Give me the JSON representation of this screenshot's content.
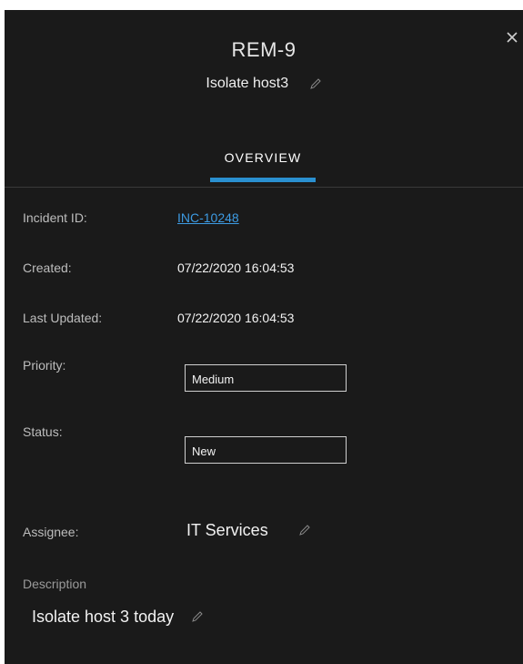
{
  "header": {
    "ticket_id": "REM-9",
    "title": "Isolate host3",
    "close_icon": "close-icon",
    "edit_icon": "pencil-icon"
  },
  "tabs": [
    {
      "label": "OVERVIEW",
      "active": true
    }
  ],
  "fields": {
    "incident_id": {
      "label": "Incident ID:",
      "value": "INC-10248"
    },
    "created": {
      "label": "Created:",
      "value": "07/22/2020 16:04:53"
    },
    "last_updated": {
      "label": "Last Updated:",
      "value": "07/22/2020 16:04:53"
    },
    "priority": {
      "label": "Priority:",
      "value": "Medium"
    },
    "status": {
      "label": "Status:",
      "value": "New"
    },
    "assignee": {
      "label": "Assignee:",
      "value": "IT Services"
    }
  },
  "description": {
    "label": "Description",
    "value": "Isolate host 3 today"
  },
  "colors": {
    "background": "#1a1a1a",
    "accent": "#2a90d0",
    "link": "#3d9be3"
  }
}
